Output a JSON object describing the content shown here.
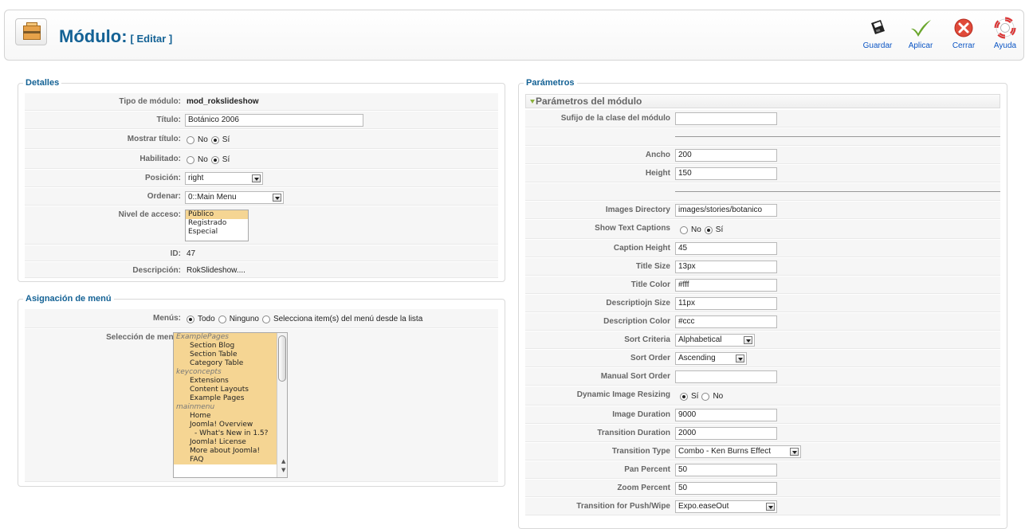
{
  "header": {
    "title": "Módulo:",
    "subtitle": "[ Editar ]",
    "buttons": {
      "save": "Guardar",
      "apply": "Aplicar",
      "close": "Cerrar",
      "help": "Ayuda"
    }
  },
  "details": {
    "legend": "Detalles",
    "type_label": "Tipo de módulo:",
    "type_value": "mod_rokslideshow",
    "title_label": "Título:",
    "title_value": "Botánico 2006",
    "show_title_label": "Mostrar título:",
    "enabled_label": "Habilitado:",
    "no": "No",
    "yes": "Sí",
    "position_label": "Posición:",
    "position_value": "right",
    "order_label": "Ordenar:",
    "order_value": "0::Main Menu",
    "access_label": "Nivel de acceso:",
    "access_options": [
      "Público",
      "Registrado",
      "Especial"
    ],
    "access_selected": "Público",
    "id_label": "ID:",
    "id_value": "47",
    "description_label": "Descripción:",
    "description_value": "RokSlideshow...."
  },
  "menu_assignment": {
    "legend": "Asignación de menú",
    "menus_label": "Menús:",
    "all": "Todo",
    "none": "Ninguno",
    "select_from_list": "Selecciona item(s) del menú desde la lista",
    "selection_label": "Selección de menú:",
    "items": [
      {
        "text": "ExamplePages",
        "group": true
      },
      {
        "text": "Section Blog",
        "group": false
      },
      {
        "text": "Section Table",
        "group": false
      },
      {
        "text": "Category Table",
        "group": false
      },
      {
        "text": "keyconcepts",
        "group": true
      },
      {
        "text": "Extensions",
        "group": false
      },
      {
        "text": "Content Layouts",
        "group": false
      },
      {
        "text": "Example Pages",
        "group": false
      },
      {
        "text": "mainmenu",
        "group": true
      },
      {
        "text": "Home",
        "group": false
      },
      {
        "text": "Joomla! Overview",
        "group": false
      },
      {
        "text": "- What's New in 1.5?",
        "group": false
      },
      {
        "text": "Joomla! License",
        "group": false
      },
      {
        "text": "More about Joomla!",
        "group": false
      },
      {
        "text": "FAQ",
        "group": false
      }
    ]
  },
  "parameters": {
    "legend": "Parámetros",
    "section_title": "Parámetros del módulo",
    "class_suffix_label": "Sufijo de la clase del módulo",
    "class_suffix_value": "",
    "width_label": "Ancho",
    "width_value": "200",
    "height_label": "Height",
    "height_value": "150",
    "images_dir_label": "Images Directory",
    "images_dir_value": "images/stories/botanico",
    "captions_label": "Show Text Captions",
    "no": "No",
    "yes": "Sí",
    "caption_height_label": "Caption Height",
    "caption_height_value": "45",
    "title_size_label": "Title Size",
    "title_size_value": "13px",
    "title_color_label": "Title Color",
    "title_color_value": "#fff",
    "desc_size_label": "Descriptiojn Size",
    "desc_size_value": "11px",
    "desc_color_label": "Description Color",
    "desc_color_value": "#ccc",
    "sort_criteria_label": "Sort Criteria",
    "sort_criteria_value": "Alphabetical",
    "sort_order_label": "Sort Order",
    "sort_order_value": "Ascending",
    "manual_sort_label": "Manual Sort Order",
    "manual_sort_value": "",
    "dynamic_resize_label": "Dynamic Image Resizing",
    "image_duration_label": "Image Duration",
    "image_duration_value": "9000",
    "transition_duration_label": "Transition Duration",
    "transition_duration_value": "2000",
    "transition_type_label": "Transition Type",
    "transition_type_value": "Combo - Ken Burns Effect",
    "pan_label": "Pan Percent",
    "pan_value": "50",
    "zoom_label": "Zoom Percent",
    "zoom_value": "50",
    "push_wipe_label": "Transition for Push/Wipe",
    "push_wipe_value": "Expo.easeOut"
  },
  "colors": {
    "title_blue": "#146295",
    "link_blue": "#0b55c4",
    "selected_item": "#f5d593"
  }
}
